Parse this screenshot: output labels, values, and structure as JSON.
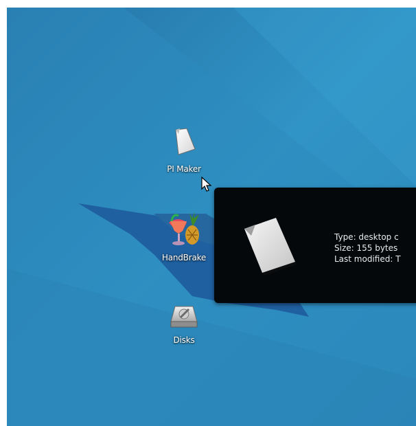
{
  "desktop": {
    "icons": [
      {
        "label": "PI Maker",
        "icon": "document-icon"
      },
      {
        "label": "HandBrake",
        "icon": "handbrake-icon"
      },
      {
        "label": "Disks",
        "icon": "disk-drive-icon"
      }
    ]
  },
  "tooltip": {
    "type_line": "Type: desktop c",
    "size_line": "Size: 155 bytes",
    "modified_line": "Last modified: T",
    "preview_icon": "document-icon"
  },
  "colors": {
    "wallpaper": "#2f8cbf",
    "tooltip_bg": "#05080b",
    "tooltip_text": "#e9ecef"
  }
}
